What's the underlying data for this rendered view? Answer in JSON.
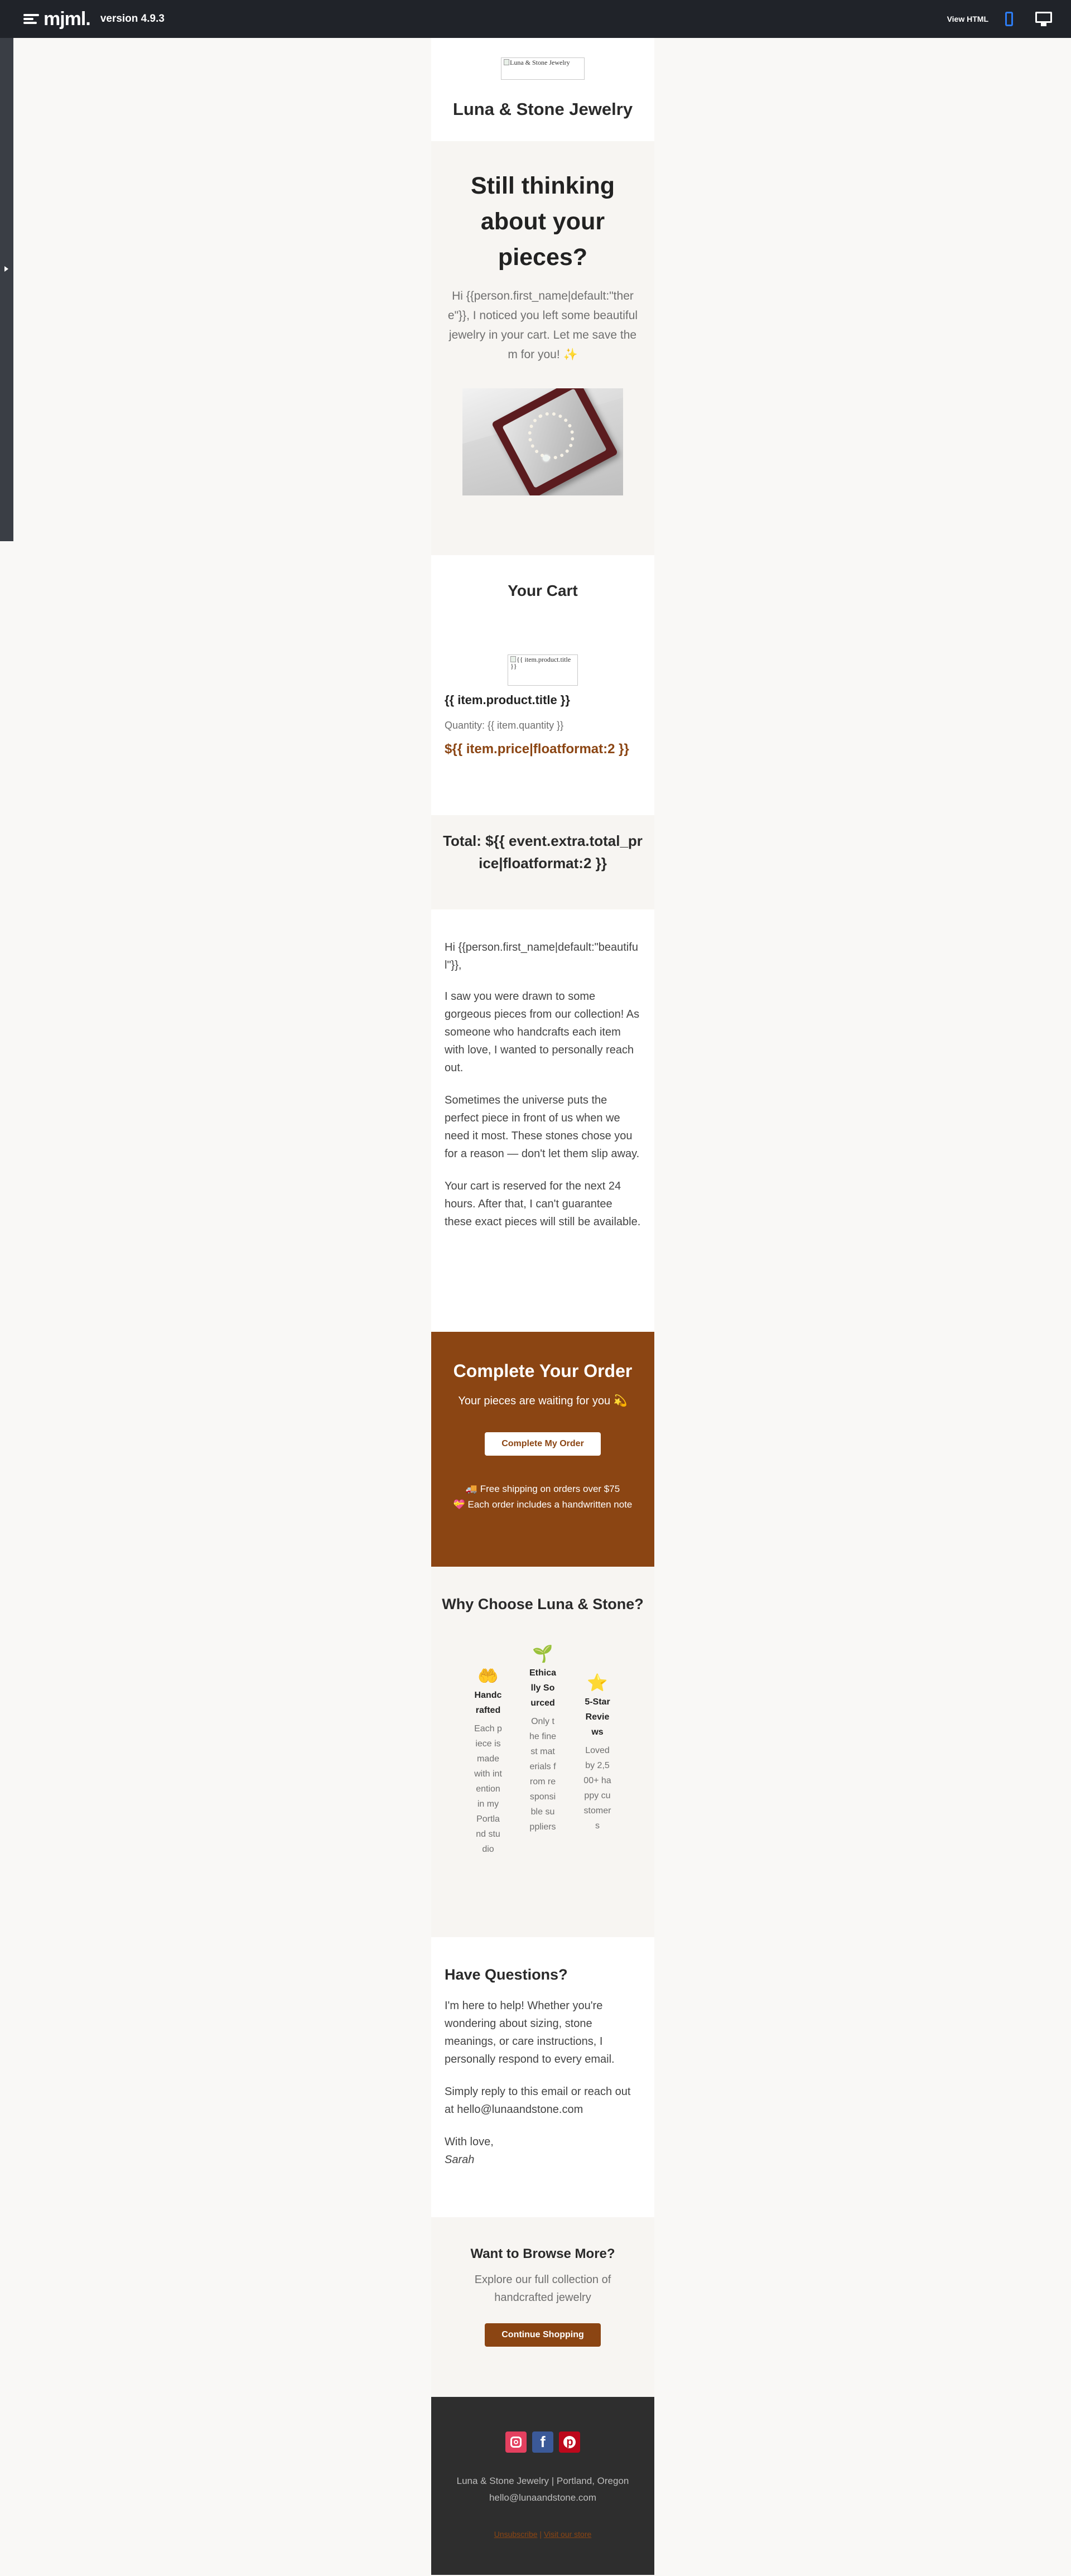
{
  "toolbar": {
    "logo": "mjml.",
    "version": "version 4.9.3",
    "view_html": "View HTML"
  },
  "icons": {
    "mobile": "mobile-preview-icon",
    "desktop": "desktop-preview-icon",
    "sidebar_toggle": "chevron-right-icon"
  },
  "header": {
    "logo_alt": "Luna & Stone Jewelry",
    "brand": "Luna & Stone Jewelry"
  },
  "hero": {
    "title": "Still thinking about your pieces?",
    "text": "Hi {{person.first_name|default:\"there\"}}, I noticed you left some beautiful jewelry in your cart. Let me save them for you! ✨"
  },
  "cart": {
    "title": "Your Cart",
    "image_alt": "{{ item.product.title }}",
    "product_title": "{{ item.product.title }}",
    "quantity": "Quantity: {{ item.quantity }}",
    "price": "${{ item.price|floatformat:2 }}",
    "total": "Total: ${{ event.extra.total_price|floatformat:2 }}"
  },
  "letter": {
    "greeting": "Hi {{person.first_name|default:\"beautiful\"}},",
    "p1": "I saw you were drawn to some gorgeous pieces from our collection! As someone who handcrafts each item with love, I wanted to personally reach out.",
    "p2": "Sometimes the universe puts the perfect piece in front of us when we need it most. These stones chose you for a reason — don't let them slip away.",
    "p3": "Your cart is reserved for the next 24 hours. After that, I can't guarantee these exact pieces will still be available."
  },
  "cta": {
    "title": "Complete Your Order",
    "subtitle": "Your pieces are waiting for you 💫",
    "button": "Complete My Order",
    "perk1": "🚚 Free shipping on orders over $75",
    "perk2": "💝 Each order includes a handwritten note"
  },
  "why": {
    "title": "Why Choose Luna & Stone?",
    "features": [
      {
        "icon": "🤲",
        "title": "Handcrafted",
        "text": "Each piece is made with intention in my Portland studio"
      },
      {
        "icon": "🌱",
        "title": "Ethically Sourced",
        "text": "Only the finest materials from responsible suppliers"
      },
      {
        "icon": "⭐",
        "title": "5-Star Reviews",
        "text": "Loved by 2,500+ happy customers"
      }
    ]
  },
  "questions": {
    "title": "Have Questions?",
    "p1": "I'm here to help! Whether you're wondering about sizing, stone meanings, or care instructions, I personally respond to every email.",
    "p2": "Simply reply to this email or reach out at hello@lunaandstone.com",
    "signoff": "With love,",
    "signature": "Sarah"
  },
  "browse": {
    "title": "Want to Browse More?",
    "text": "Explore our full collection of handcrafted jewelry",
    "button": "Continue Shopping"
  },
  "footer": {
    "address": "Luna & Stone Jewelry | Portland, Oregon",
    "email": "hello@lunaandstone.com",
    "unsubscribe": "Unsubscribe",
    "separator": " | ",
    "visit": "Visit our store",
    "social": [
      "instagram-icon",
      "facebook-icon",
      "pinterest-icon"
    ]
  },
  "colors": {
    "accent": "#8b4513",
    "topbar": "#202329",
    "footer": "#2e2e2e",
    "cream": "#f7f5f2"
  }
}
